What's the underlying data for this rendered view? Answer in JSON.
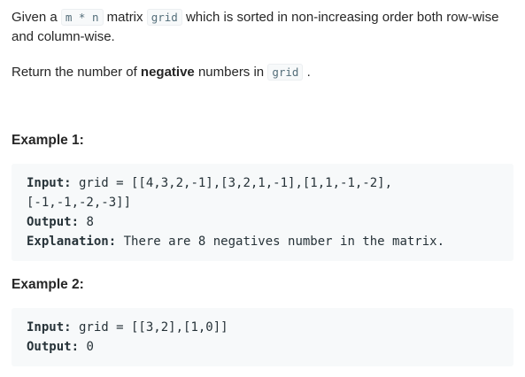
{
  "description": {
    "p1_given": "Given a ",
    "p1_code_mn": "m * n",
    "p1_matrix": " matrix ",
    "p1_code_grid": "grid",
    "p1_rest_line1": " which is sorted in non-increasing order both row-wise",
    "p1_line2": "and column-wise.",
    "p2_return": "Return the number of ",
    "p2_bold": "negative",
    "p2_numbers_in": " numbers in ",
    "p2_code_grid": "grid",
    "p2_period": " ."
  },
  "examples": [
    {
      "heading": "Example 1:",
      "input_label": "Input:",
      "input_line1": " grid = [[4,3,2,-1],[3,2,1,-1],[1,1,-1,-2],",
      "input_line2": "[-1,-1,-2,-3]]",
      "output_label": "Output:",
      "output_value": " 8",
      "explanation_label": "Explanation:",
      "explanation_value": " There are 8 negatives number in the matrix."
    },
    {
      "heading": "Example 2:",
      "input_label": "Input:",
      "input_line1": " grid = [[3,2],[1,0]]",
      "output_label": "Output:",
      "output_value": " 0"
    }
  ]
}
